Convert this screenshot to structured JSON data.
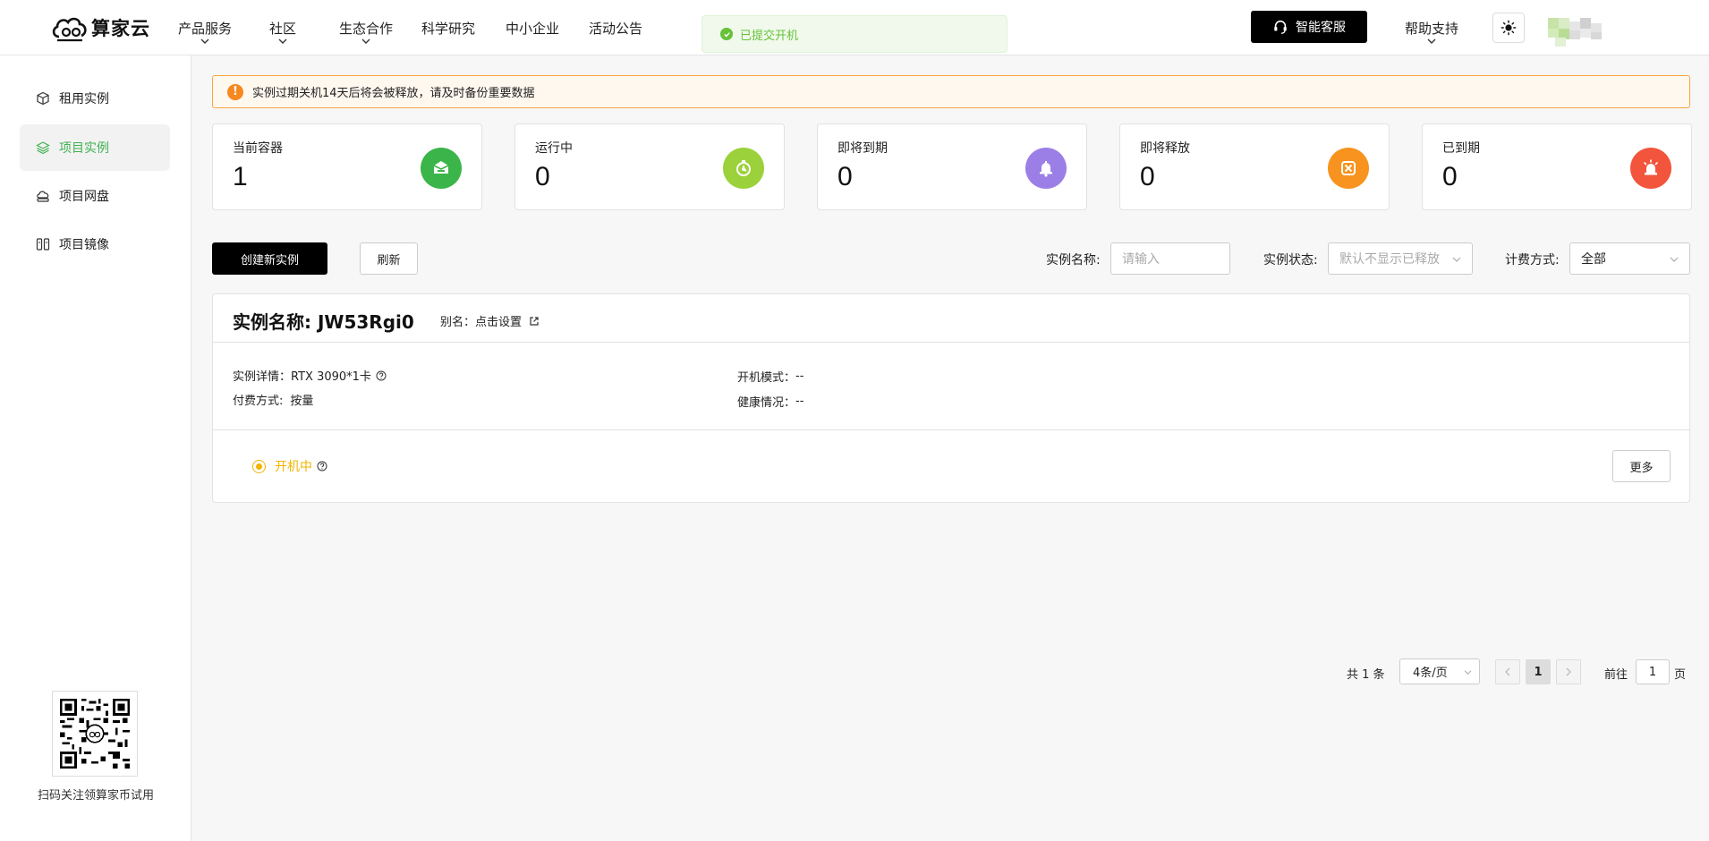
{
  "header": {
    "logo_text": "算家云",
    "nav": [
      {
        "label": "产品服务",
        "dropdown": true
      },
      {
        "label": "社区",
        "dropdown": true
      },
      {
        "label": "生态合作",
        "dropdown": true
      },
      {
        "label": "科学研究",
        "dropdown": false
      },
      {
        "label": "中小企业",
        "dropdown": false
      },
      {
        "label": "活动公告",
        "dropdown": false
      }
    ],
    "toast": "已提交开机",
    "service_label": "智能客服",
    "help_label": "帮助支持"
  },
  "sidebar": {
    "items": [
      {
        "label": "租用实例",
        "icon": "cube-icon",
        "active": false
      },
      {
        "label": "项目实例",
        "icon": "layers-icon",
        "active": true
      },
      {
        "label": "项目网盘",
        "icon": "cloud-disk-icon",
        "active": false
      },
      {
        "label": "项目镜像",
        "icon": "image-mirror-icon",
        "active": false
      }
    ],
    "qr_caption": "扫码关注领算家币试用"
  },
  "alert": "实例过期关机14天后将会被释放，请及时备份重要数据",
  "stats": [
    {
      "label": "当前容器",
      "value": "1",
      "color": "#3bb44a",
      "icon": "container-icon"
    },
    {
      "label": "运行中",
      "value": "0",
      "color": "#9bd13a",
      "icon": "timer-icon"
    },
    {
      "label": "即将到期",
      "value": "0",
      "color": "#9b7fe6",
      "icon": "bell-icon"
    },
    {
      "label": "即将释放",
      "value": "0",
      "color": "#f7931e",
      "icon": "release-icon"
    },
    {
      "label": "已到期",
      "value": "0",
      "color": "#f2553b",
      "icon": "alarm-icon"
    }
  ],
  "toolbar": {
    "create_label": "创建新实例",
    "refresh_label": "刷新",
    "name_label": "实例名称:",
    "name_placeholder": "请输入",
    "status_label": "实例状态:",
    "status_placeholder": "默认不显示已释放",
    "billing_label": "计费方式:",
    "billing_value": "全部"
  },
  "instance": {
    "title": "实例名称:  JW53Rgi0",
    "alias_label": "别名：点击设置",
    "detail_label": "实例详情：",
    "detail_value": "RTX 3090*1卡",
    "pay_label": "付费方式:",
    "pay_value": "按量",
    "boot_label": "开机模式：",
    "boot_value": "--",
    "health_label": "健康情况：",
    "health_value": "--",
    "status": "开机中",
    "more_label": "更多"
  },
  "pagination": {
    "total": "共 1 条",
    "page_size": "4条/页",
    "current_page": "1",
    "goto_label": "前往",
    "goto_value": "1",
    "page_suffix": "页"
  }
}
